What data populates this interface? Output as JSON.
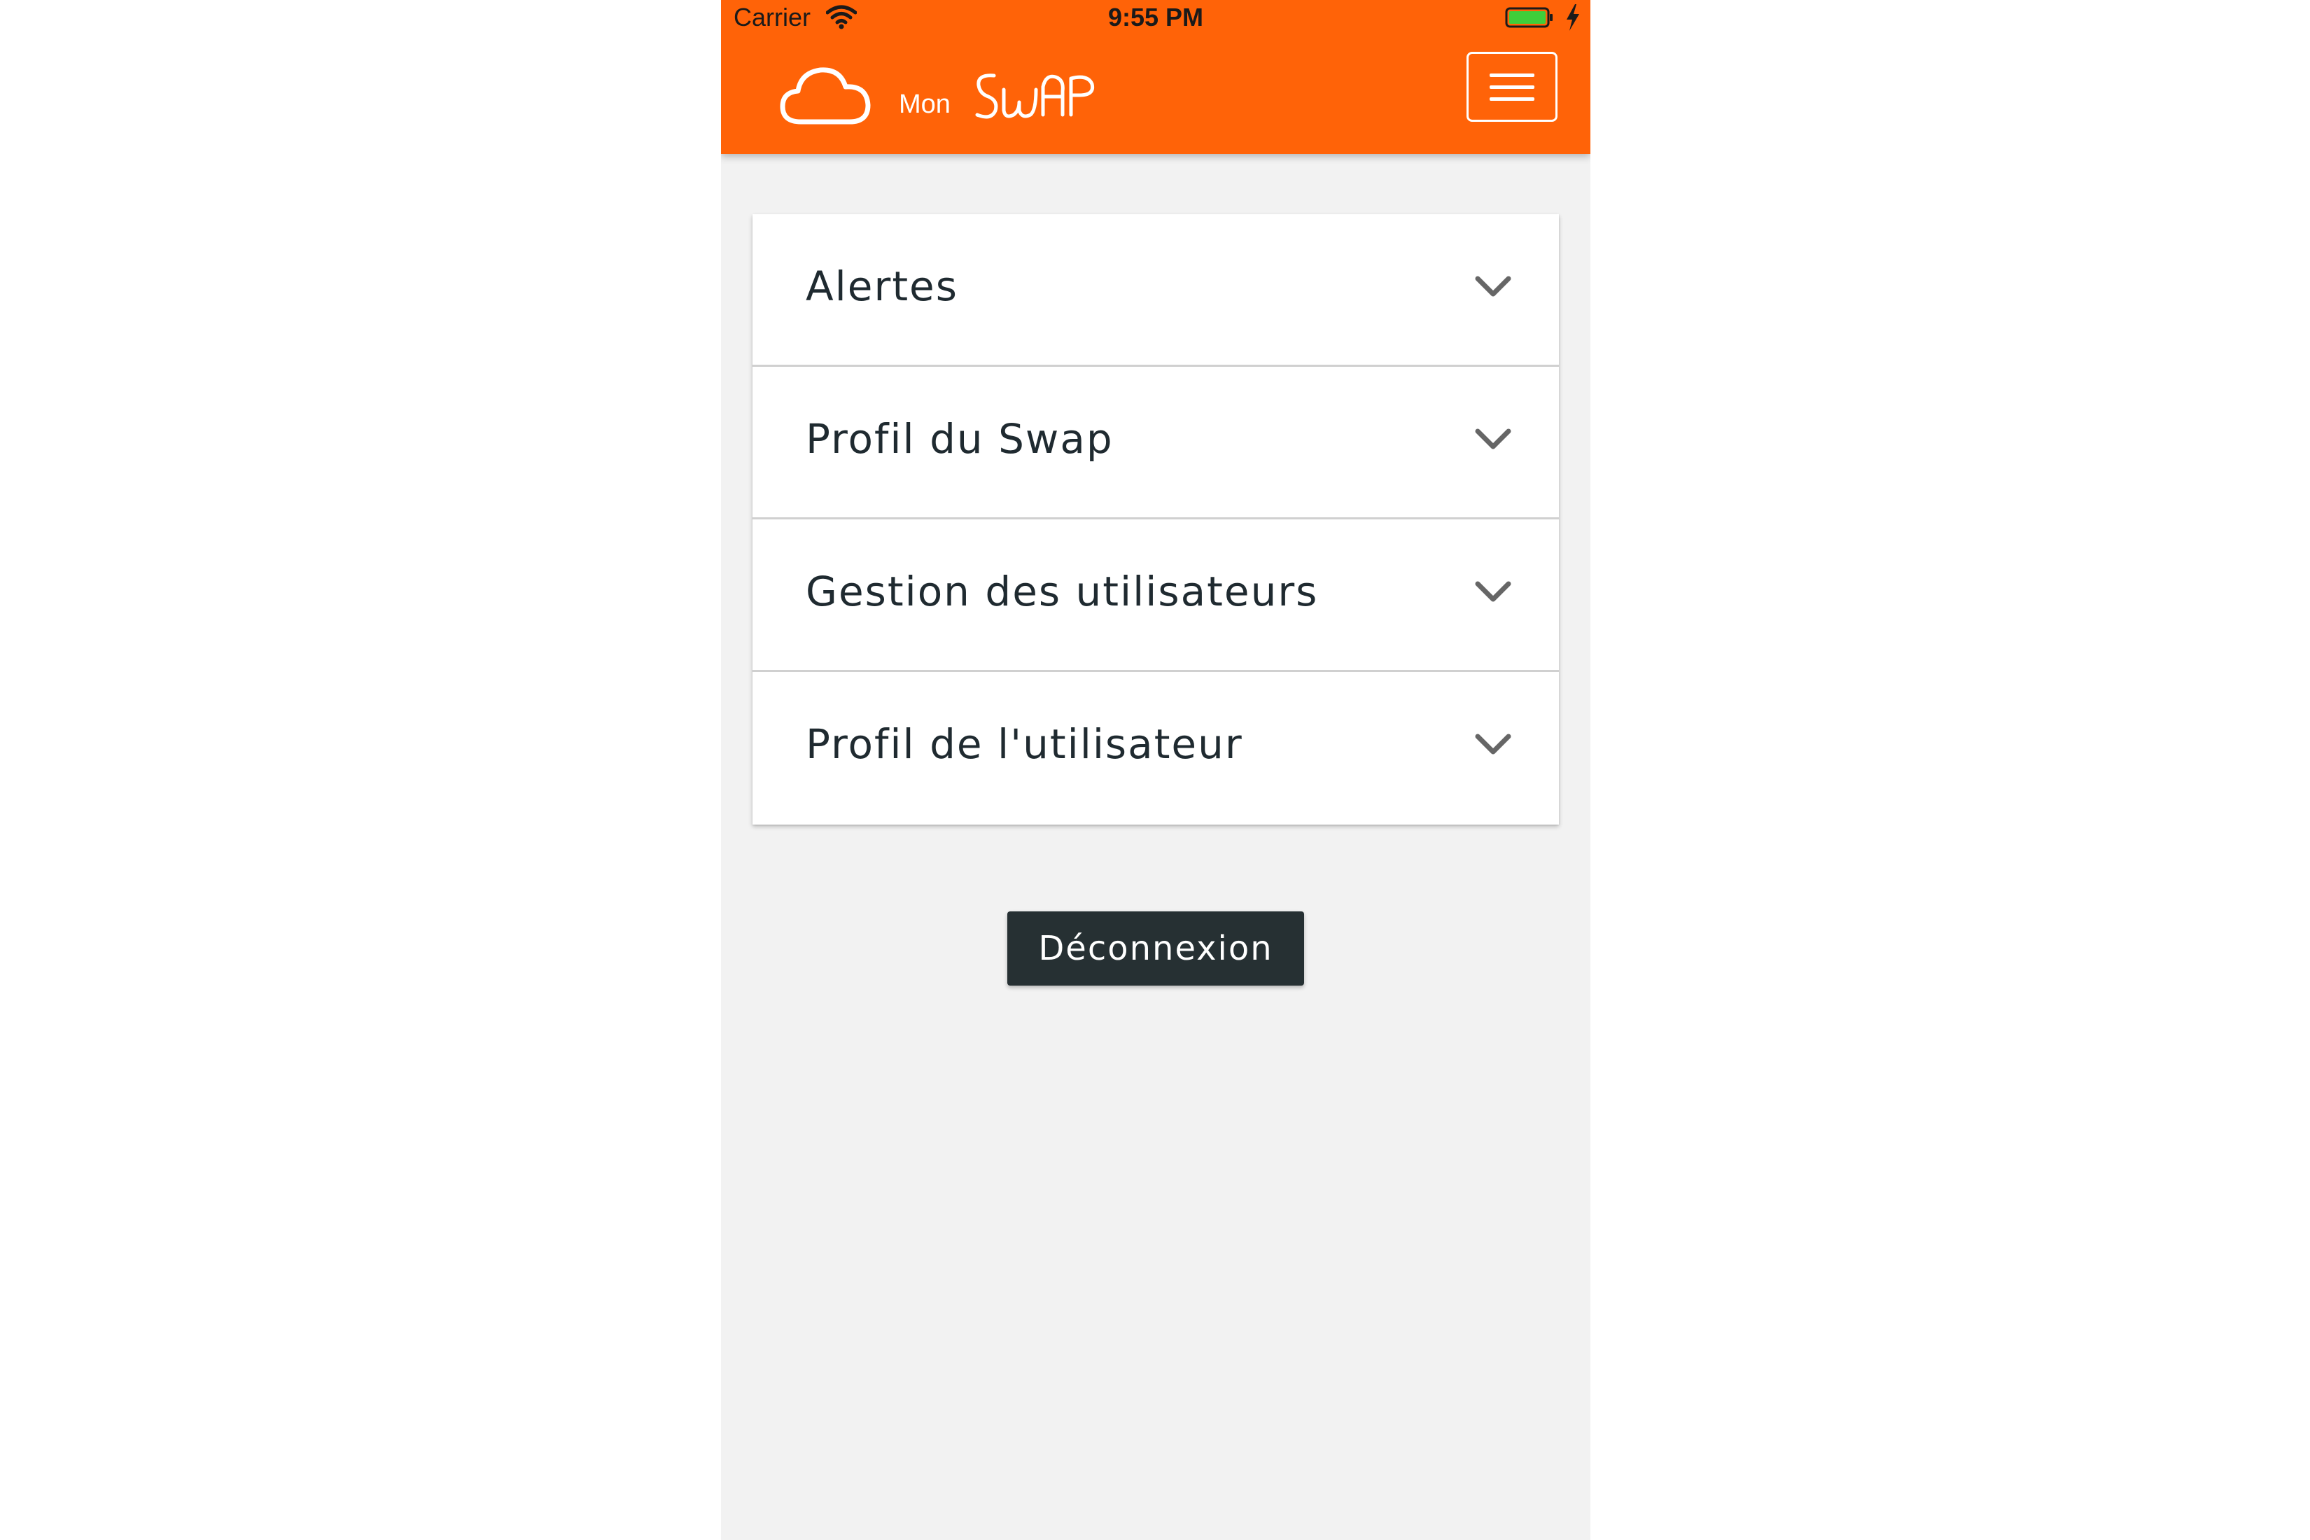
{
  "status_bar": {
    "carrier": "Carrier",
    "time": "9:55 PM",
    "wifi_icon": "wifi-icon",
    "battery_icon": "battery-charging-icon",
    "battery_color": "#3fce3a"
  },
  "header": {
    "logo_mon": "Mon",
    "logo_swap": "SWAP",
    "logo_icon": "cloud-icon",
    "menu_icon": "hamburger-menu-icon",
    "background_color": "#ff6308"
  },
  "accordion": {
    "items": [
      {
        "label": "Alertes",
        "icon": "chevron-down-icon"
      },
      {
        "label": "Profil du Swap",
        "icon": "chevron-down-icon"
      },
      {
        "label": "Gestion des utilisateurs",
        "icon": "chevron-down-icon"
      },
      {
        "label": "Profil de l'utilisateur",
        "icon": "chevron-down-icon"
      }
    ]
  },
  "logout_button": {
    "label": "Déconnexion",
    "background_color": "#263033"
  }
}
